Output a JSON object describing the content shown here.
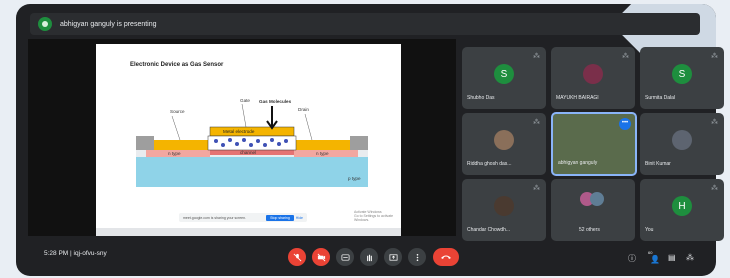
{
  "banner": {
    "text": "abhigyan ganguly is presenting"
  },
  "slide": {
    "title": "Electronic Device as Gas Sensor",
    "labels": {
      "gate": "Gate",
      "gas_molecules": "Gas Molecules",
      "source": "Source",
      "drain": "Drain",
      "metal_electrode": "Metal electrode",
      "channel": "channel",
      "n_type_left": "n type",
      "n_type_right": "n type",
      "p_type": "p type"
    },
    "share_bar": {
      "text": "meet.google.com is sharing your screen.",
      "stop": "Stop sharing",
      "hide": "Hide"
    },
    "watermark_line1": "Activate Windows",
    "watermark_line2": "Go to Settings to activate Windows."
  },
  "participants": [
    {
      "name": "Shubho Das",
      "initial": "S",
      "kind": "initial"
    },
    {
      "name": "MAYUKH BAIRAGI",
      "kind": "photo"
    },
    {
      "name": "Surmita Dalal",
      "initial": "S",
      "kind": "initial"
    },
    {
      "name": "Riddha ghosh das...",
      "kind": "photo"
    },
    {
      "name": "abhigyan ganguly",
      "kind": "video"
    },
    {
      "name": "Binit Kumar",
      "kind": "photo"
    },
    {
      "name": "Chandar Chowdh...",
      "kind": "photo"
    },
    {
      "name": "52 others",
      "kind": "group"
    },
    {
      "name": "You",
      "initial": "H",
      "kind": "initial"
    }
  ],
  "footer": {
    "time": "5:28 PM",
    "separator": "|",
    "meeting_code": "iqj-ofvu-sny",
    "participant_count": "60"
  },
  "colors": {
    "background": "#202124",
    "tile": "#3c4043",
    "accent_green": "#1e8e3e",
    "danger": "#ea4335",
    "highlight": "#8ab4f8"
  }
}
